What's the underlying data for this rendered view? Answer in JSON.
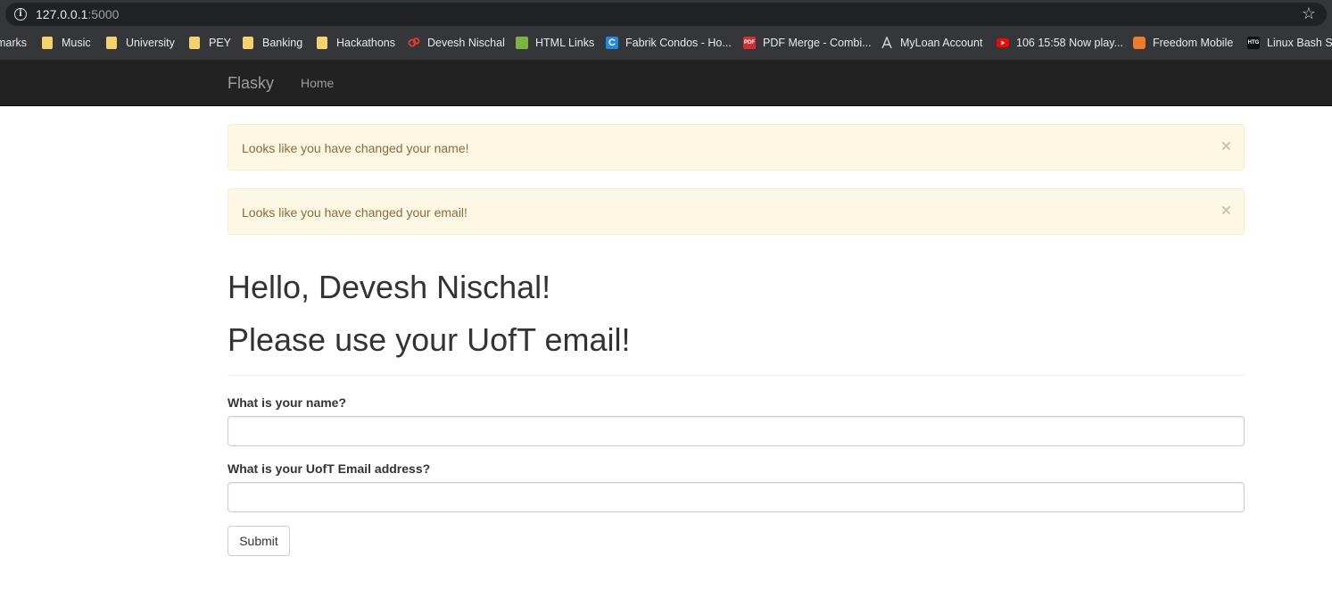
{
  "browser": {
    "url_host": "127.0.0.1",
    "url_port": ":5000",
    "bookmarks": [
      {
        "label": "marks",
        "icon": "none"
      },
      {
        "label": "Music",
        "icon": "folder-icon"
      },
      {
        "label": "University",
        "icon": "folder-icon"
      },
      {
        "label": "PEY",
        "icon": "folder-icon"
      },
      {
        "label": "Banking",
        "icon": "folder-icon"
      },
      {
        "label": "Hackathons",
        "icon": "folder-icon"
      },
      {
        "label": "Devesh Nischal",
        "icon": "site-icon"
      },
      {
        "label": "HTML Links",
        "icon": "site-icon"
      },
      {
        "label": "Fabrik Condos - Ho...",
        "icon": "site-icon"
      },
      {
        "label": "PDF Merge - Combi...",
        "icon": "pdf-icon"
      },
      {
        "label": "MyLoan Account",
        "icon": "site-icon"
      },
      {
        "label": "106 15:58 Now play...",
        "icon": "youtube-icon"
      },
      {
        "label": "Freedom Mobile",
        "icon": "site-icon"
      },
      {
        "label": "Linux Bash Sh",
        "icon": "site-icon"
      }
    ],
    "icon_glyphs": {
      "pdf": "PDF",
      "htg": "HTG",
      "c": "C",
      "star": "☆",
      "info": "i"
    }
  },
  "navbar": {
    "brand": "Flasky",
    "home": "Home"
  },
  "alerts": [
    {
      "message": "Looks like you have changed your name!",
      "close": "×"
    },
    {
      "message": "Looks like you have changed your email!",
      "close": "×"
    }
  ],
  "page": {
    "greeting": "Hello, Devesh Nischal!",
    "uoft_message": "Please use your UofT email!"
  },
  "form": {
    "name_label": "What is your name?",
    "name_value": "",
    "email_label": "What is your UofT Email address?",
    "email_value": "",
    "submit_label": "Submit"
  },
  "colors": {
    "navbar_bg": "#222222",
    "alert_bg": "#fcf8e3",
    "alert_text": "#8a6d3b",
    "browser_chrome": "#35363a"
  }
}
